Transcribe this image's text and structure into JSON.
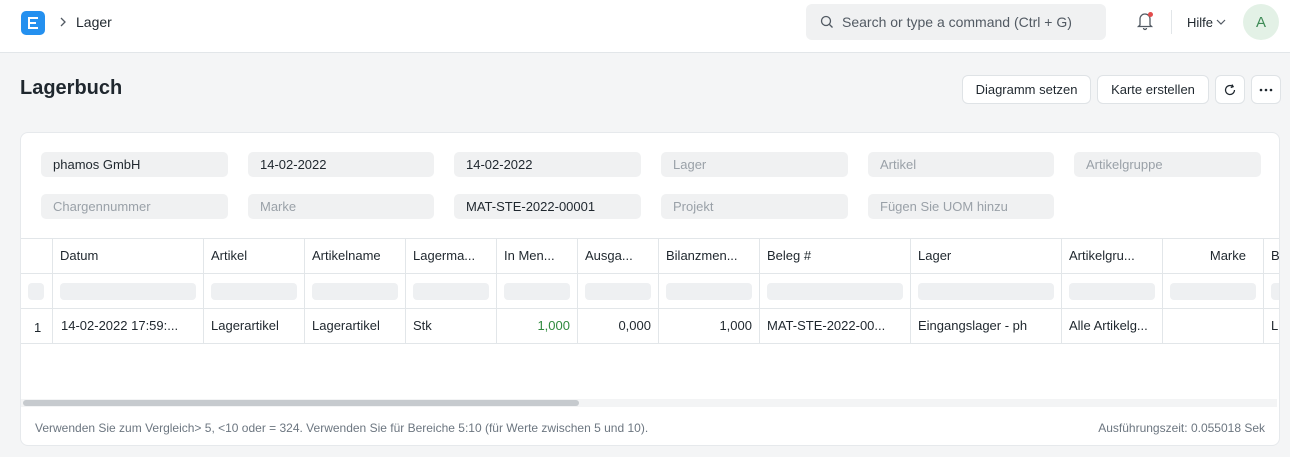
{
  "navbar": {
    "breadcrumb": "Lager",
    "search_placeholder": "Search or type a command (Ctrl + G)",
    "help_label": "Hilfe",
    "avatar_initial": "A",
    "accent": "#2490ef"
  },
  "page": {
    "title": "Lagerbuch",
    "buttons": {
      "set_chart": "Diagramm setzen",
      "create_card": "Karte erstellen"
    }
  },
  "filters": {
    "company": "phamos GmbH",
    "from_date": "14-02-2022",
    "to_date": "14-02-2022",
    "warehouse": "Lager",
    "item": "Artikel",
    "item_group": "Artikelgruppe",
    "batch_no": "Chargennummer",
    "brand": "Marke",
    "voucher_no": "MAT-STE-2022-00001",
    "project": "Projekt",
    "uom": "Fügen Sie UOM hinzu"
  },
  "table": {
    "columns": [
      "Datum",
      "Artikel",
      "Artikelname",
      "Lagerma...",
      "In Men...",
      "Ausga...",
      "Bilanzmen...",
      "Beleg #",
      "Lager",
      "Artikelgru...",
      "Marke",
      "B"
    ],
    "rows": [
      {
        "index": "1",
        "date": "14-02-2022 17:59:...",
        "item": "Lagerartikel",
        "item_name": "Lagerartikel",
        "uom": "Stk",
        "in_qty": "1,000",
        "out_qty": "0,000",
        "balance_qty": "1,000",
        "voucher": "MAT-STE-2022-00...",
        "warehouse": "Eingangslager - ph",
        "item_group": "Alle Artikelg...",
        "brand": "",
        "extra": "L"
      }
    ]
  },
  "footer": {
    "hint": "Verwenden Sie zum Vergleich> 5, <10 oder = 324. Verwenden Sie für Bereiche 5:10 (für Werte zwischen 5 und 10).",
    "exec_time": "Ausführungszeit: 0.055018 Sek"
  }
}
